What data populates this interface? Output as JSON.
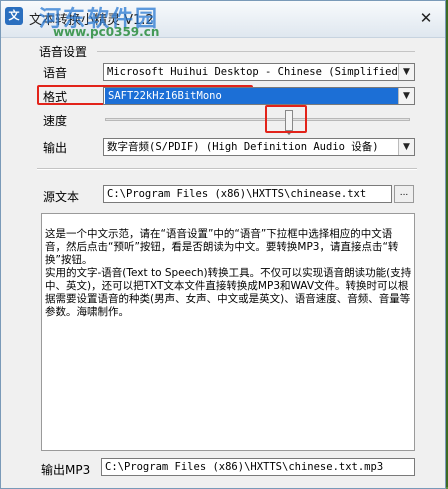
{
  "window": {
    "title": "文本转换小精灵 V1.2",
    "close_symbol": "✕"
  },
  "watermark": {
    "site_name": "河东软件园",
    "url": "www.pc0359.cn"
  },
  "voice_settings": {
    "group_label": "语音设置",
    "voice_label": "语音",
    "voice_value": "Microsoft Huihui Desktop - Chinese (Simplified)",
    "format_label": "格式",
    "format_value": "SAFT22kHz16BitMono",
    "speed_label": "速度",
    "speed_level": 0.6,
    "output_label": "输出",
    "output_value": "数字音频(S/PDIF) (High Definition Audio 设备)"
  },
  "source": {
    "label": "源文本",
    "path": "C:\\Program Files (x86)\\HXTTS\\chinease.txt",
    "browse_label": "..."
  },
  "editor": {
    "text": "这是一个中文示范，请在“语音设置”中的“语音”下拉框中选择相应的中文语音，然后点击“预听”按钮，看是否朗读为中文。要转换MP3，请直接点击“转换”按钮。\n实用的文字-语音(Text to Speech)转换工具。不仅可以实现语音朗读功能(支持中、英文)，还可以把TXT文本文件直接转换成MP3和WAV文件。转换时可以根据需要设置语音的种类(男声、女声、中文或是英文)、语音速度、音频、音量等参数。海啸制作。"
  },
  "output_file": {
    "label": "输出MP3",
    "path": "C:\\Program Files (x86)\\HXTTS\\chinese.txt.mp3"
  },
  "icons": {
    "dropdown": "▼",
    "app": "文"
  }
}
